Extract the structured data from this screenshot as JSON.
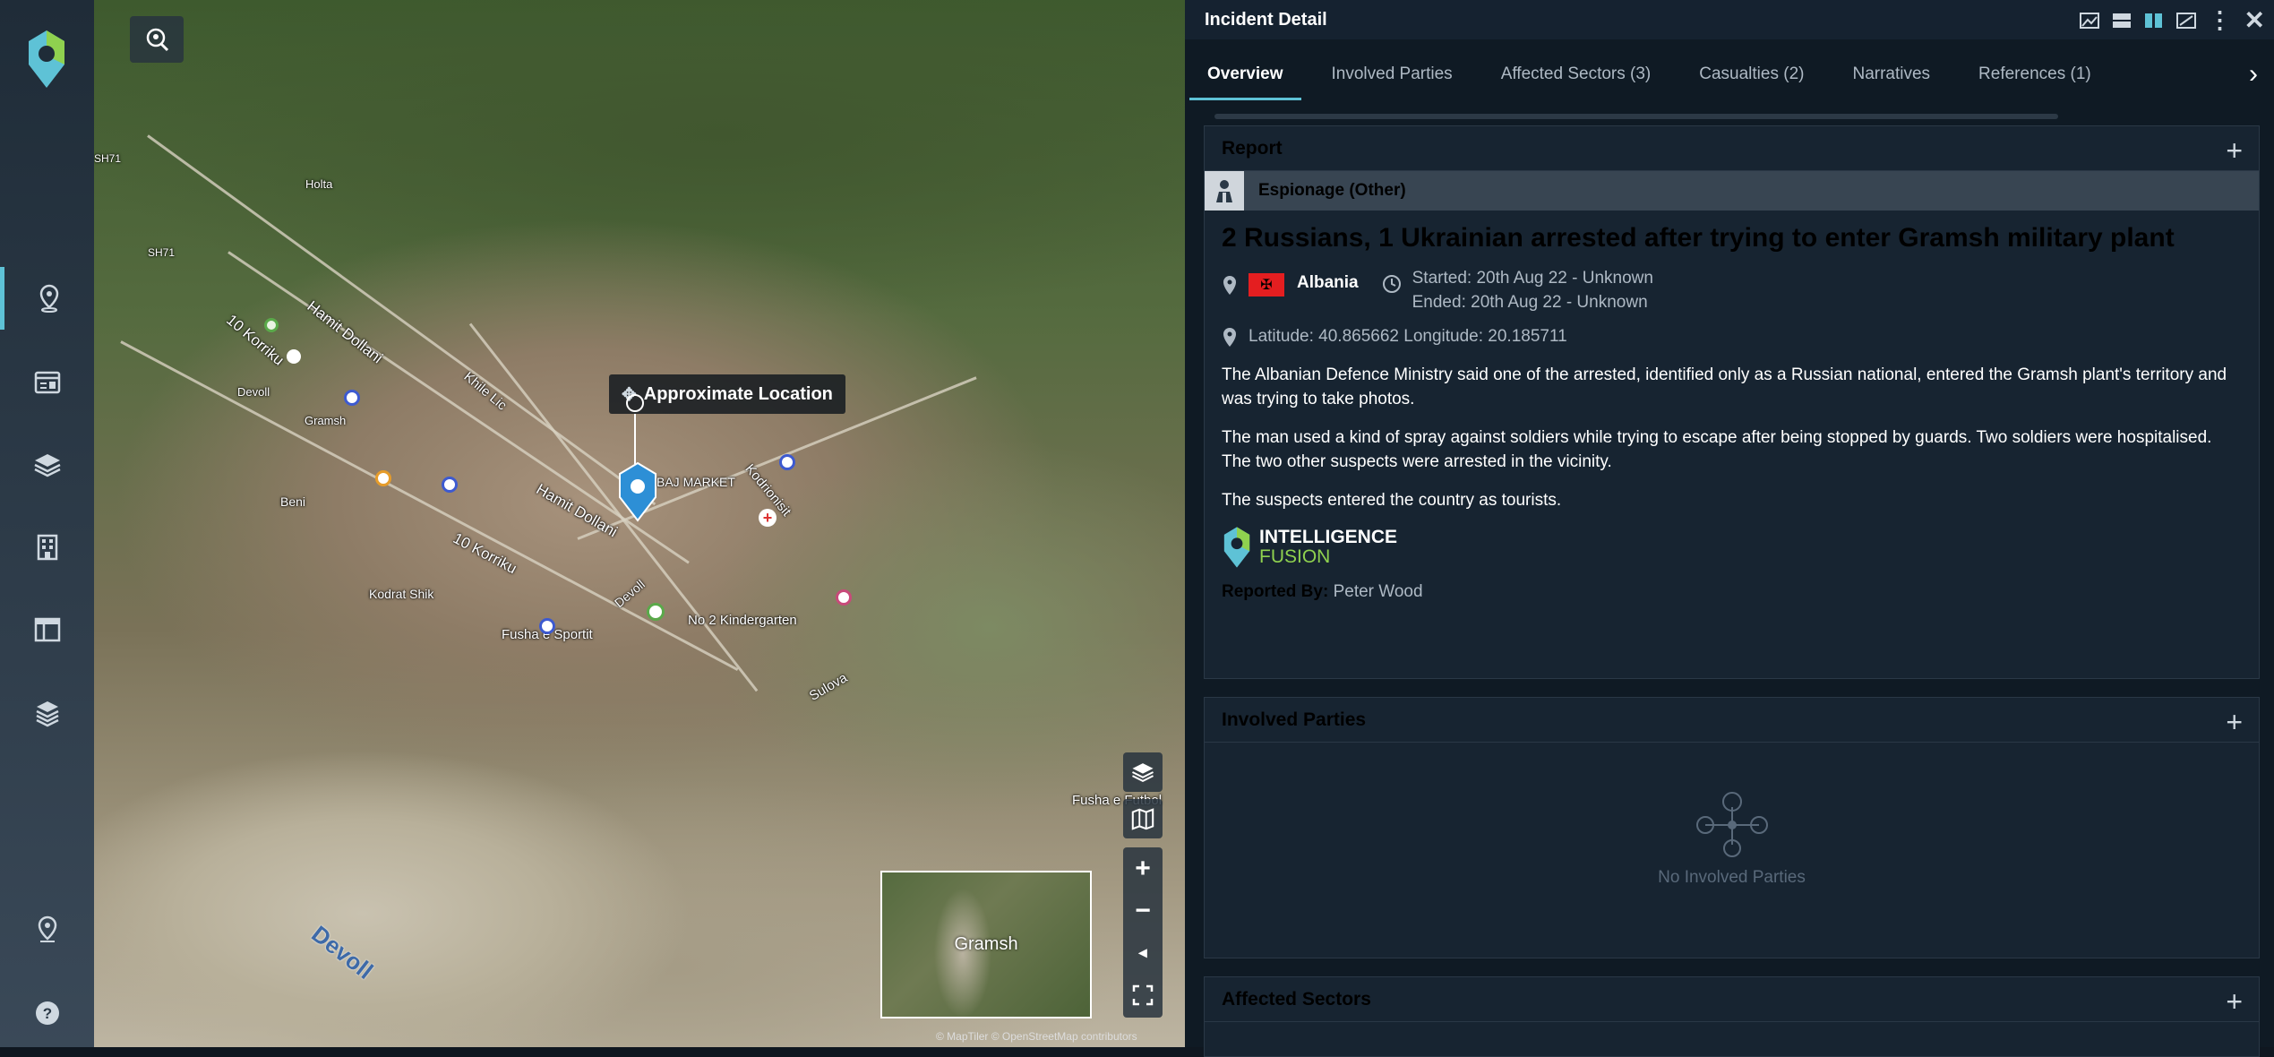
{
  "sidebar": {
    "items": [
      "map-pin",
      "incident-list",
      "layers",
      "buildings",
      "dashboard",
      "layered-stack"
    ],
    "bottom_items": [
      "location-pin",
      "help"
    ],
    "accent": "#5ec2d6"
  },
  "map": {
    "labels": {
      "hamit_dollani_1": "Hamit Dollani",
      "hamit_dollani_2": "Hamit Dollani",
      "korriku_1": "10 Korriku",
      "korriku_2": "10 Korriku",
      "holta": "Holta",
      "khile": "Khile Lic",
      "kodrionisit": "Kodrionisit",
      "bajmarket": "BAJ MARKET",
      "beni": "Beni",
      "fusha_sportit": "Fusha e Sportit",
      "kinderg": "No 2 Kindergarten",
      "sulova": "Sulova",
      "fusha_futbol": "Fusha e Futbol",
      "devoll": "Devoll",
      "sh71_1": "SH71",
      "sh71_2": "SH71",
      "gramsh_small": "Gramsh",
      "devoll_small": "Devoll",
      "kodrat": "Kodrat Shik",
      "gramsh_label": "Gramsh"
    },
    "tooltip": "Approximate Location",
    "minimap_label": "Gramsh",
    "attribution": "© MapTiler © OpenStreetMap contributors"
  },
  "panel": {
    "title": "Incident Detail",
    "tabs": [
      {
        "label": "Overview",
        "active": true
      },
      {
        "label": "Involved Parties"
      },
      {
        "label": "Affected Sectors (3)"
      },
      {
        "label": "Casualties (2)"
      },
      {
        "label": "Narratives"
      },
      {
        "label": "References (1)"
      }
    ],
    "report": {
      "header": "Report",
      "category": "Espionage (Other)",
      "title": "2 Russians, 1 Ukrainian arrested after trying to enter Gramsh military plant",
      "country": "Albania",
      "started": "Started: 20th Aug 22 - Unknown",
      "ended": "Ended: 20th Aug 22 - Unknown",
      "coords": "Latitude: 40.865662 Longitude: 20.185711",
      "paragraphs": [
        "The Albanian Defence Ministry said one of the arrested, identified only as a Russian national, entered the Gramsh plant's territory and was trying to take photos.",
        "The man used a kind of spray against soldiers while trying to escape after being stopped by guards. Two soldiers were hospitalised. The two other suspects were arrested in the vicinity.",
        "The suspects entered the country as tourists."
      ],
      "source_logo_line1": "INTELLIGENCE",
      "source_logo_line2": "FUSION",
      "reported_by_label": "Reported By:",
      "reported_by": "Peter Wood"
    },
    "involved_parties": {
      "header": "Involved Parties",
      "empty": "No Involved Parties"
    },
    "affected_sectors": {
      "header": "Affected Sectors"
    }
  }
}
